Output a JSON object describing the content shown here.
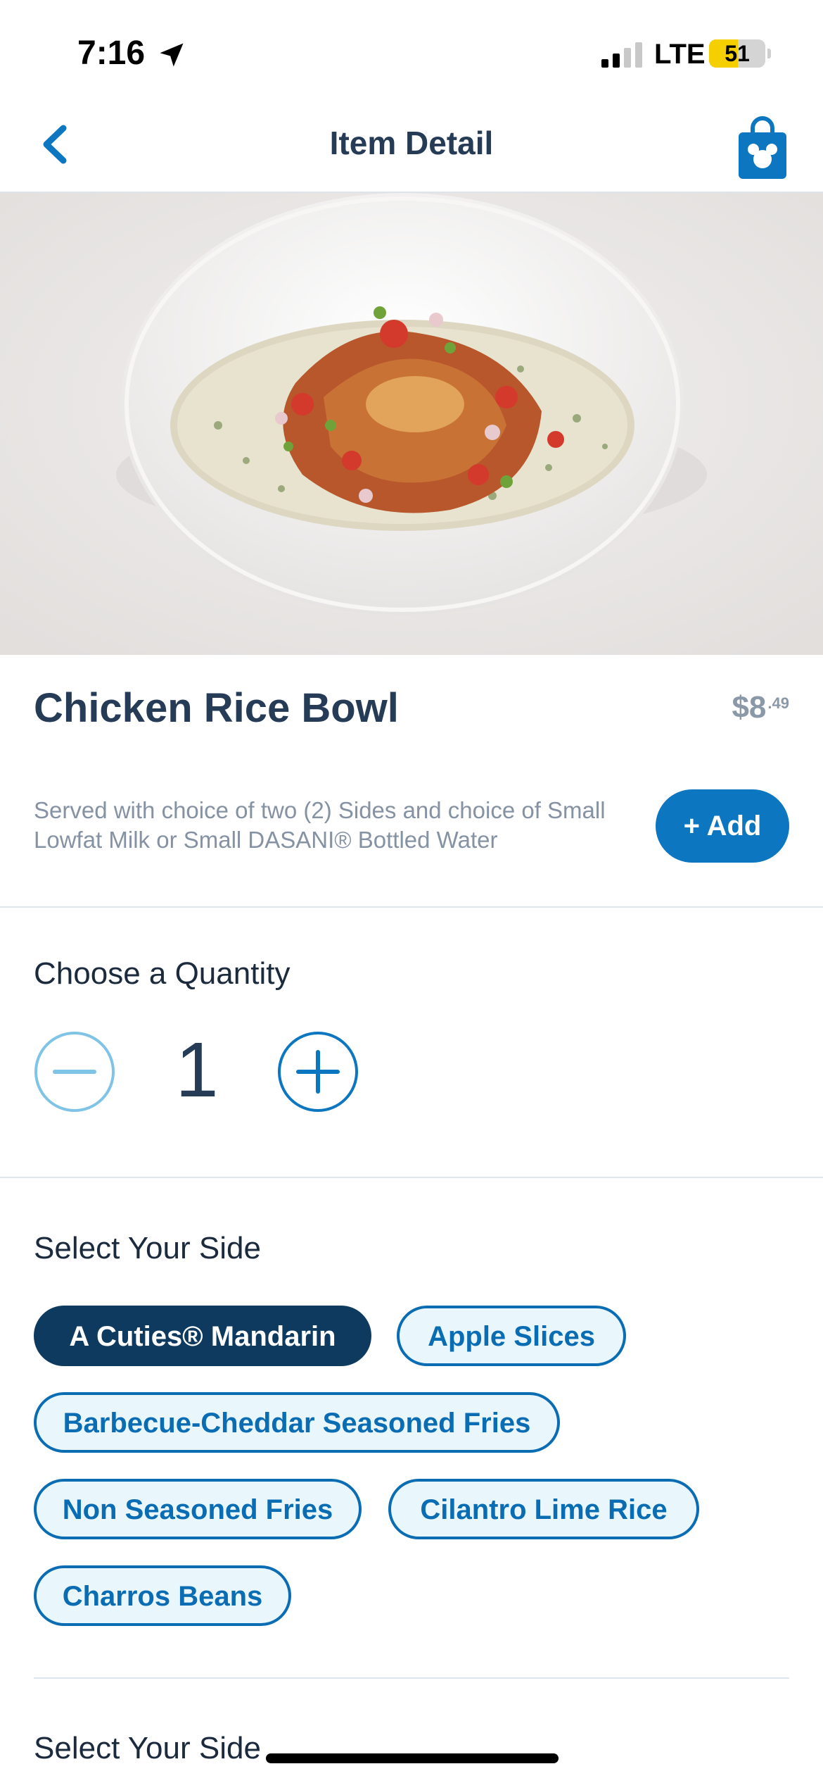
{
  "status_bar": {
    "time": "7:16",
    "network": "LTE",
    "battery": "51",
    "battery_level": 0.51
  },
  "nav": {
    "title": "Item Detail",
    "back_icon": "chevron-left-icon",
    "bag_icon": "mickey-shopping-bag-icon"
  },
  "hero": {
    "image": "chicken-rice-bowl-photo"
  },
  "item": {
    "name": "Chicken Rice Bowl",
    "price_dollars": "$8",
    "price_cents": ".49",
    "description": "Served with choice of two (2) Sides and choice of Small Lowfat Milk or Small DASANI® Bottled Water",
    "add_label": "+ Add"
  },
  "quantity": {
    "title": "Choose a Quantity",
    "value": "1"
  },
  "sides": {
    "title": "Select Your Side",
    "options": [
      {
        "label": "A Cuties® Mandarin",
        "selected": true
      },
      {
        "label": "Apple Slices",
        "selected": false
      },
      {
        "label": "Barbecue-Cheddar Seasoned Fries",
        "selected": false
      },
      {
        "label": "Non Seasoned Fries",
        "selected": false
      },
      {
        "label": "Cilantro Lime Rice",
        "selected": false
      },
      {
        "label": "Charros Beans",
        "selected": false
      }
    ]
  },
  "sides2": {
    "title": "Select Your Side"
  },
  "colors": {
    "accent": "#0c76c0",
    "selected_chip": "#0d3a5e",
    "title": "#253b56"
  }
}
